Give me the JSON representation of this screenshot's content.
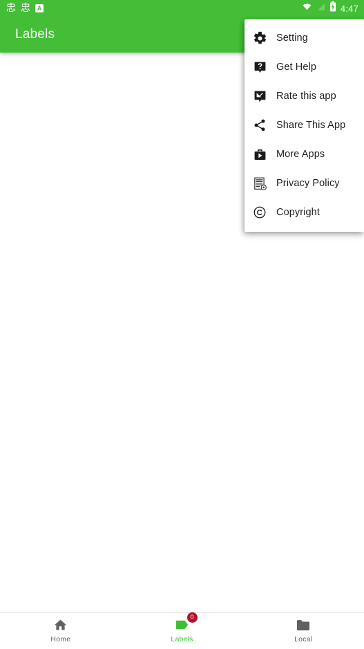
{
  "status_bar": {
    "left_glyphs": [
      "忠",
      "忠"
    ],
    "alarm_badge": "A",
    "icons": [
      "wifi-icon",
      "signal-off-icon",
      "battery-icon"
    ],
    "time": "4:47"
  },
  "app_bar": {
    "title": "Labels",
    "background_color": "#43be36",
    "title_color": "#ffffff"
  },
  "overflow_menu": {
    "items": [
      {
        "label": "Setting",
        "icon": "gear-icon"
      },
      {
        "label": "Get Help",
        "icon": "help-badge-icon"
      },
      {
        "label": "Rate this app",
        "icon": "rate-review-icon"
      },
      {
        "label": "Share This App",
        "icon": "share-icon"
      },
      {
        "label": "More Apps",
        "icon": "business-center-play-icon"
      },
      {
        "label": "Privacy Policy",
        "icon": "policy-document-icon"
      },
      {
        "label": "Copyright",
        "icon": "copyright-icon"
      }
    ]
  },
  "bottom_nav": {
    "active_color": "#3fbe32",
    "inactive_color": "#616161",
    "badge_color": "#b4102a",
    "items": [
      {
        "label": "Home",
        "icon": "home-icon",
        "active": false,
        "badge": null
      },
      {
        "label": "Labels",
        "icon": "label-tag-icon",
        "active": true,
        "badge": "0"
      },
      {
        "label": "Local",
        "icon": "folder-icon",
        "active": false,
        "badge": null
      }
    ]
  }
}
